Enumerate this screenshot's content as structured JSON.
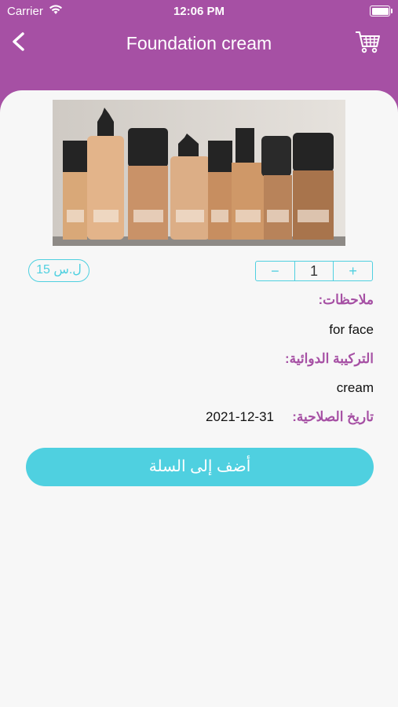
{
  "status_bar": {
    "carrier": "Carrier",
    "time": "12:06 PM"
  },
  "nav": {
    "title": "Foundation cream"
  },
  "product": {
    "image_alt": "MAC",
    "price": "15 ل.س",
    "quantity": "1",
    "notes_label": "ملاحظات:",
    "notes_value": "for face",
    "formula_label": "التركيبة الدوائية:",
    "formula_value": "cream",
    "expiry_label": "تاريخ الصلاحية:",
    "expiry_value": "2021-12-31"
  },
  "actions": {
    "add_to_cart": "أضف إلى السلة",
    "decrement": "−",
    "increment": "+"
  },
  "colors": {
    "header": "#a650a4",
    "accent": "#4fd0e0",
    "background": "#f7f7f7"
  }
}
